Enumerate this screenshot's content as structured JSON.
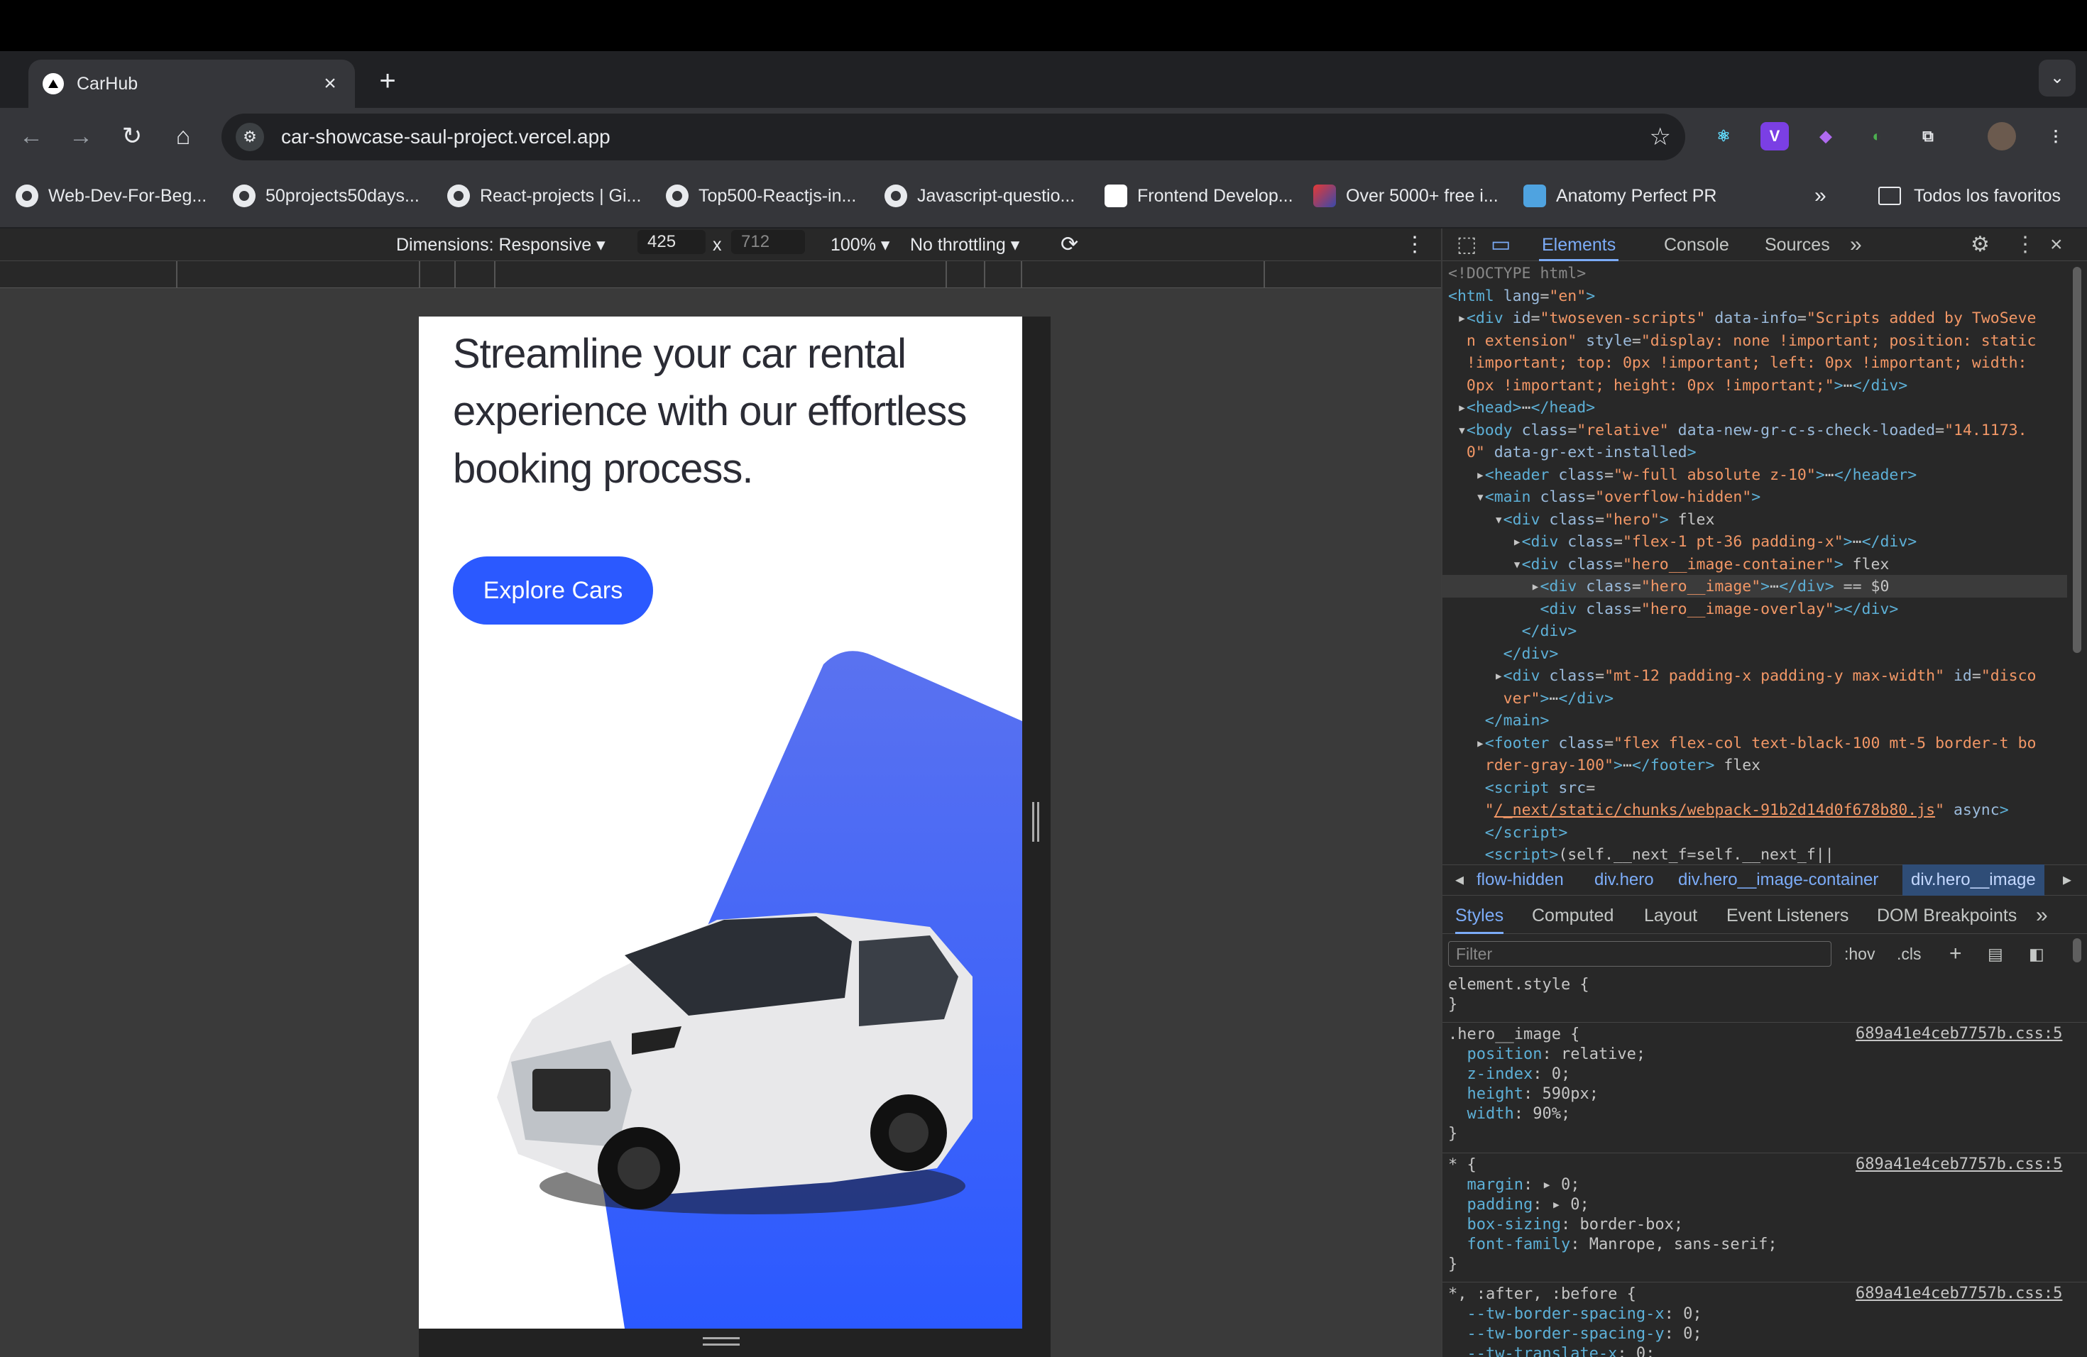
{
  "browser": {
    "tab_title": "CarHub",
    "url": "car-showcase-saul-project.vercel.app",
    "bookmarks": [
      "Web-Dev-For-Beg...",
      "50projects50days...",
      "React-projects | Gi...",
      "Top500-Reactjs-in...",
      "Javascript-questio...",
      "Frontend Develop...",
      "Over 5000+ free i...",
      "Anatomy Perfect PR"
    ],
    "bookmarks_more": "»",
    "all_bookmarks": "Todos los favoritos"
  },
  "device_toolbar": {
    "dimensions": "Dimensions: Responsive ▾",
    "width": "425",
    "times": "x",
    "height": "712",
    "zoom": "100% ▾",
    "throttling": "No throttling ▾"
  },
  "page": {
    "hero_title": "Streamline your car rental experience with our effortless booking process.",
    "explore_button": "Explore Cars",
    "accent": "#2B59FF"
  },
  "devtools": {
    "tabs": [
      "Elements",
      "Console",
      "Sources"
    ],
    "more": "»",
    "breadcrumbs": [
      "flow-hidden",
      "div.hero",
      "div.hero__image-container",
      "div.hero__image"
    ],
    "style_tabs": [
      "Styles",
      "Computed",
      "Layout",
      "Event Listeners",
      "DOM Breakpoints"
    ],
    "filter_placeholder": "Filter",
    "hov": ":hov",
    "cls": ".cls",
    "source_file": "689a41e4ceb7757b.css:5"
  }
}
